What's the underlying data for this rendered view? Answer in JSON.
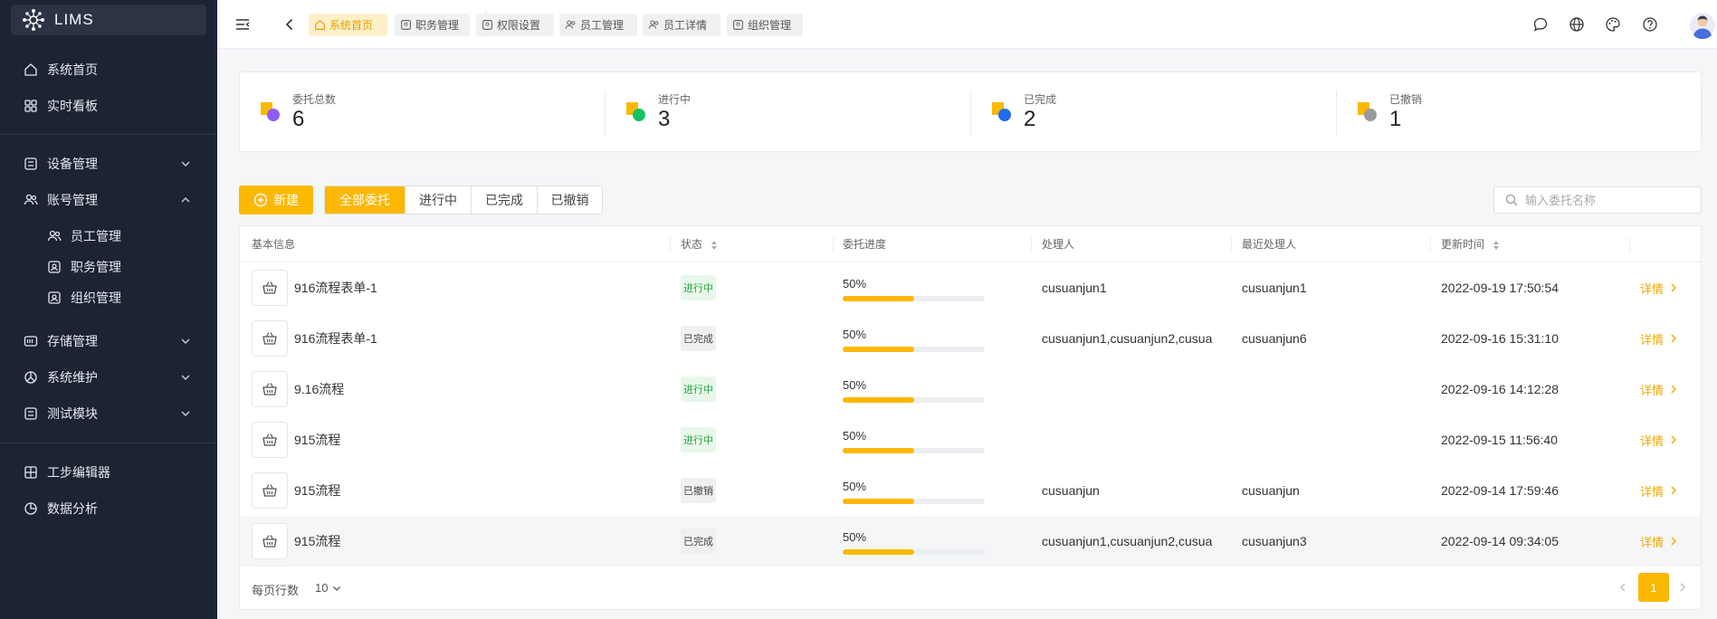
{
  "app": {
    "title": "LIMS"
  },
  "colors": {
    "accent": "#fbb800",
    "sidebar_bg": "#1c2333",
    "running": "#27a243"
  },
  "sidebar": {
    "items": [
      {
        "label": "系统首页",
        "icon": "home-icon"
      },
      {
        "label": "实时看板",
        "icon": "dashboard-icon"
      },
      {
        "label": "设备管理",
        "icon": "device-icon"
      },
      {
        "label": "账号管理",
        "icon": "users-icon"
      },
      {
        "label": "员工管理",
        "icon": "users-icon"
      },
      {
        "label": "职务管理",
        "icon": "id-card-icon"
      },
      {
        "label": "组织管理",
        "icon": "id-card-icon"
      },
      {
        "label": "存储管理",
        "icon": "storage-icon"
      },
      {
        "label": "系统维护",
        "icon": "tools-icon"
      },
      {
        "label": "测试模块",
        "icon": "test-icon"
      },
      {
        "label": "工步编辑器",
        "icon": "grid-icon"
      },
      {
        "label": "数据分析",
        "icon": "chart-icon"
      }
    ]
  },
  "tabs": [
    {
      "label": "系统首页",
      "icon": "home-icon"
    },
    {
      "label": "职务管理",
      "icon": "id-card-icon"
    },
    {
      "label": "权限设置",
      "icon": "id-card-icon"
    },
    {
      "label": "员工管理",
      "icon": "users-icon"
    },
    {
      "label": "员工详情",
      "icon": "users-icon"
    },
    {
      "label": "组织管理",
      "icon": "id-card-icon"
    }
  ],
  "stats": [
    {
      "label": "委托总数",
      "value": "6",
      "color": "#8f5bf5"
    },
    {
      "label": "进行中",
      "value": "3",
      "color": "#16c25d"
    },
    {
      "label": "已完成",
      "value": "2",
      "color": "#1f6cf0"
    },
    {
      "label": "已撤销",
      "value": "1",
      "color": "#9a9a9a"
    }
  ],
  "toolbar": {
    "new_label": "新建",
    "filters": [
      "全部委托",
      "进行中",
      "已完成",
      "已撤销"
    ],
    "search_placeholder": "输入委托名称"
  },
  "table": {
    "headers": [
      "基本信息",
      "状态",
      "委托进度",
      "处理人",
      "最近处理人",
      "更新时间"
    ],
    "rows": [
      {
        "name": "916流程表单-1",
        "status": "进行中",
        "status_type": "running",
        "progress": "50%",
        "progress_value": 0.5,
        "handler": "cusuanjun1",
        "last_handler": "cusuanjun1",
        "updated": "2022-09-19 17:50:54",
        "action": "详情"
      },
      {
        "name": "916流程表单-1",
        "status": "已完成",
        "status_type": "done",
        "progress": "50%",
        "progress_value": 0.5,
        "handler": "cusuanjun1,cusuanjun2,cusua",
        "last_handler": "cusuanjun6",
        "updated": "2022-09-16 15:31:10",
        "action": "详情"
      },
      {
        "name": "9.16流程",
        "status": "进行中",
        "status_type": "running",
        "progress": "50%",
        "progress_value": 0.5,
        "handler": "",
        "last_handler": "",
        "updated": "2022-09-16 14:12:28",
        "action": "详情"
      },
      {
        "name": "915流程",
        "status": "进行中",
        "status_type": "running",
        "progress": "50%",
        "progress_value": 0.5,
        "handler": "",
        "last_handler": "",
        "updated": "2022-09-15 11:56:40",
        "action": "详情"
      },
      {
        "name": "915流程",
        "status": "已撤销",
        "status_type": "cancel",
        "progress": "50%",
        "progress_value": 0.5,
        "handler": "cusuanjun",
        "last_handler": "cusuanjun",
        "updated": "2022-09-14 17:59:46",
        "action": "详情"
      },
      {
        "name": "915流程",
        "status": "已完成",
        "status_type": "done",
        "progress": "50%",
        "progress_value": 0.5,
        "handler": "cusuanjun1,cusuanjun2,cusua",
        "last_handler": "cusuanjun3",
        "updated": "2022-09-14 09:34:05",
        "action": "详情"
      }
    ]
  },
  "pagination": {
    "rows_label": "每页行数",
    "page_size": "10",
    "current_page": "1"
  }
}
